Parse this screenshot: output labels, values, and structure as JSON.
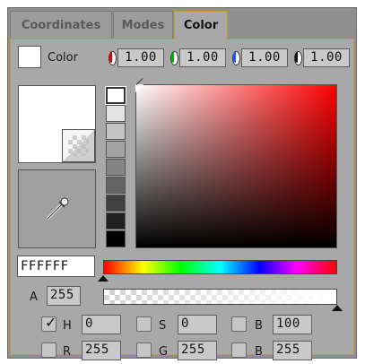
{
  "tabs": [
    {
      "label": "Coordinates",
      "active": false
    },
    {
      "label": "Modes",
      "active": false
    },
    {
      "label": "Color",
      "active": true
    }
  ],
  "header": {
    "label": "Color",
    "channels": [
      {
        "name": "red",
        "icon": "red-channel-icon",
        "value": "1.00"
      },
      {
        "name": "green",
        "icon": "green-channel-icon",
        "value": "1.00"
      },
      {
        "name": "blue",
        "icon": "blue-channel-icon",
        "value": "1.00"
      },
      {
        "name": "alpha",
        "icon": "alpha-channel-icon",
        "value": "1.00"
      }
    ]
  },
  "hex": "FFFFFF",
  "alpha": {
    "label": "A",
    "value": "255"
  },
  "hsb": [
    {
      "label": "H",
      "value": "0",
      "checked": true
    },
    {
      "label": "S",
      "value": "0",
      "checked": false
    },
    {
      "label": "B",
      "value": "100",
      "checked": false
    }
  ],
  "rgb": [
    {
      "label": "R",
      "value": "255",
      "checked": false
    },
    {
      "label": "G",
      "value": "255",
      "checked": false
    },
    {
      "label": "B",
      "value": "255",
      "checked": false
    }
  ],
  "gray_ramp": [
    "#ffffff",
    "#e4e4e4",
    "#c4c4c4",
    "#a4a4a4",
    "#848484",
    "#646464",
    "#404040",
    "#202020",
    "#000000"
  ],
  "current_color": "#ffffff",
  "hue_position": 0,
  "alpha_position": 1
}
